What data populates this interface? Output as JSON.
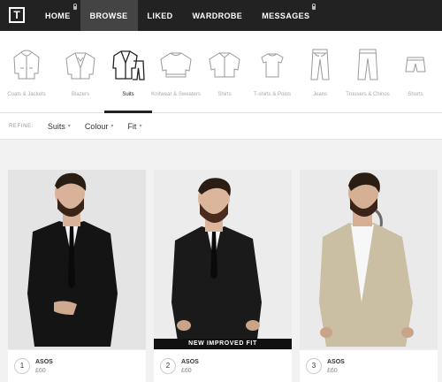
{
  "nav": {
    "logo": "T",
    "items": [
      {
        "label": "HOME",
        "active": false,
        "locked": true
      },
      {
        "label": "BROWSE",
        "active": true,
        "locked": false
      },
      {
        "label": "LIKED",
        "active": false,
        "locked": false
      },
      {
        "label": "WARDROBE",
        "active": false,
        "locked": false
      },
      {
        "label": "MESSAGES",
        "active": false,
        "locked": true
      }
    ]
  },
  "categories": [
    {
      "label": "Coats & Jackets",
      "icon": "coat-icon"
    },
    {
      "label": "Blazers",
      "icon": "blazer-icon"
    },
    {
      "label": "Suits",
      "icon": "suit-icon",
      "active": true
    },
    {
      "label": "Knitwear & Sweaters",
      "icon": "sweater-icon"
    },
    {
      "label": "Shirts",
      "icon": "shirt-icon"
    },
    {
      "label": "T-shirts & Polos",
      "icon": "tshirt-icon"
    },
    {
      "label": "Jeans",
      "icon": "jeans-icon"
    },
    {
      "label": "Trousers & Chinos",
      "icon": "trousers-icon"
    },
    {
      "label": "Shorts",
      "icon": "shorts-icon"
    }
  ],
  "refine": {
    "label": "REFINE:",
    "filters": [
      "Suits",
      "Colour",
      "Fit"
    ]
  },
  "products": [
    {
      "number": "1",
      "brand": "ASOS",
      "price": "£60",
      "badge": "",
      "suit_color": "#141414",
      "bg": "#e6e6e6"
    },
    {
      "number": "2",
      "brand": "ASOS",
      "price": "£60",
      "badge": "NEW IMPROVED FIT",
      "suit_color": "#1a1a1a",
      "bg": "#ececec"
    },
    {
      "number": "3",
      "brand": "ASOS",
      "price": "£60",
      "badge": "",
      "suit_color": "#cbbfa3",
      "bg": "#eaeaea"
    }
  ]
}
